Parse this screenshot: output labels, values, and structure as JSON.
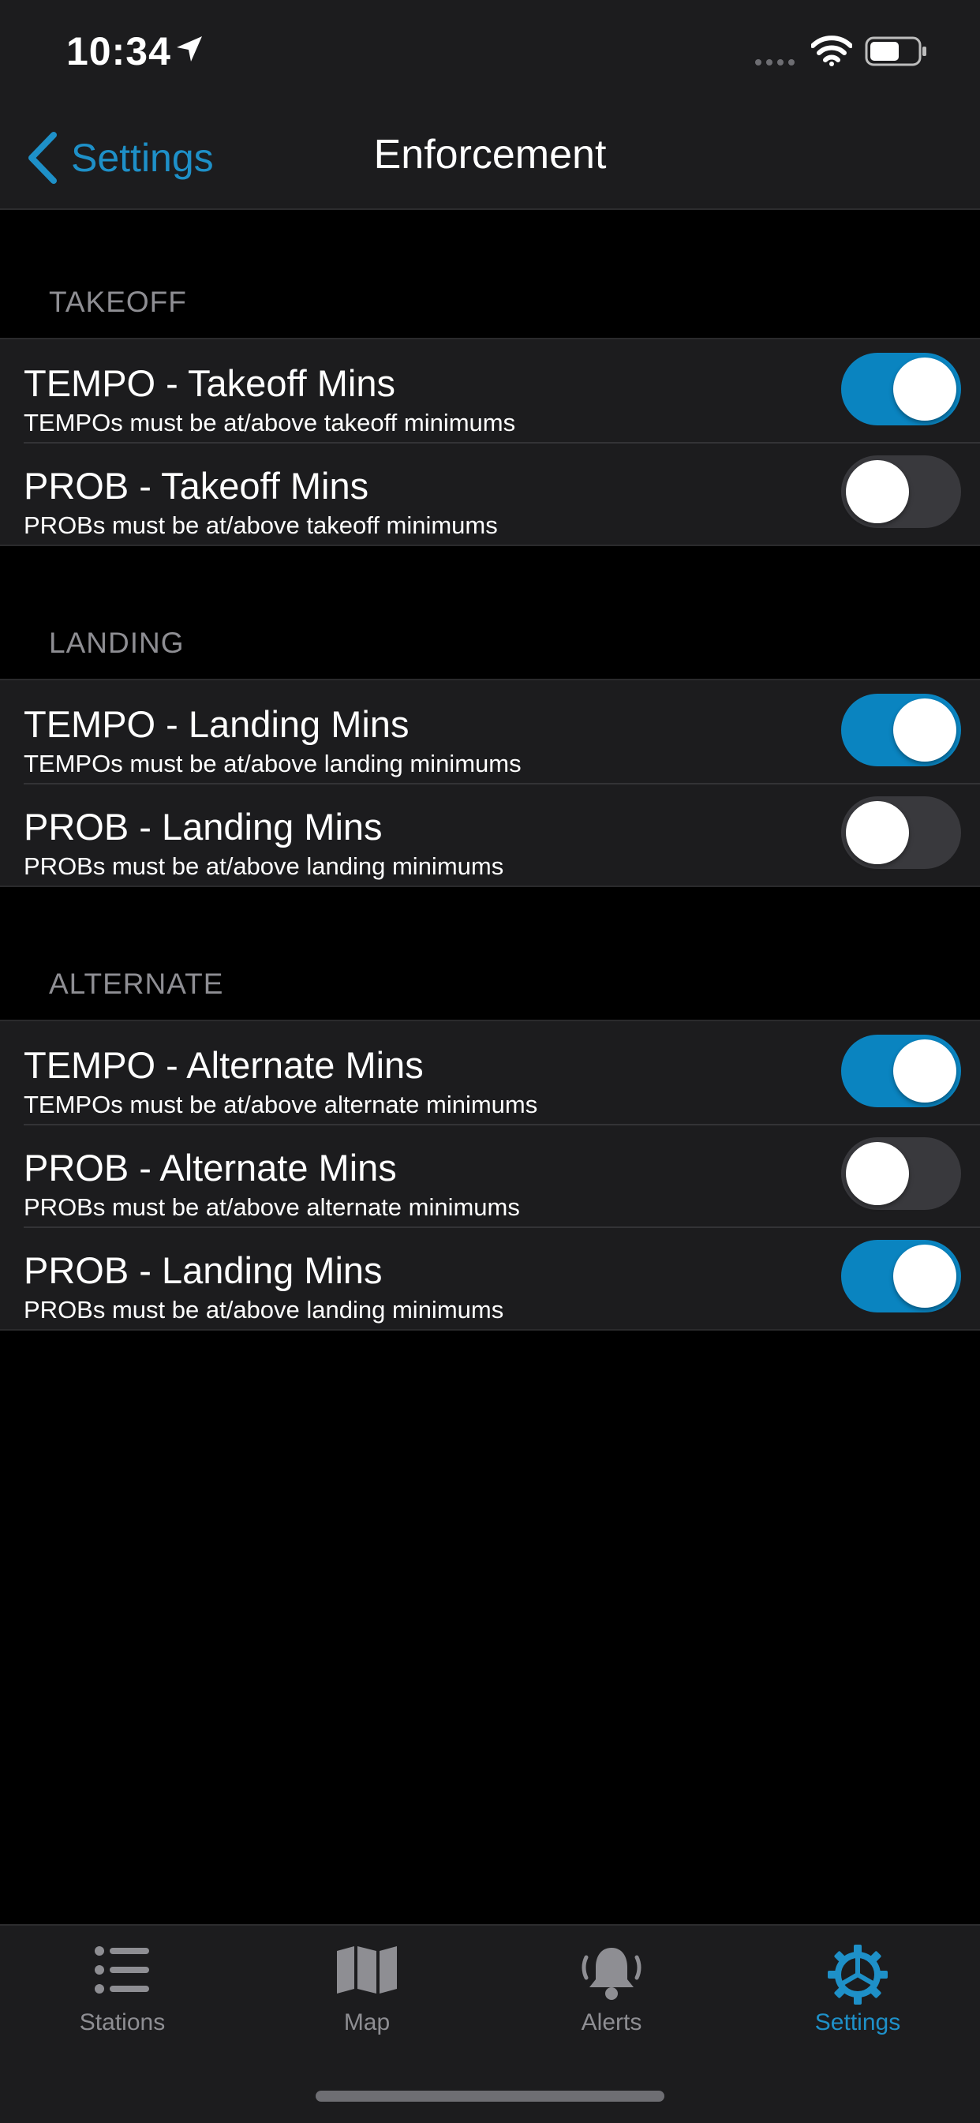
{
  "status_bar": {
    "time": "10:34"
  },
  "nav": {
    "back_label": "Settings",
    "title": "Enforcement"
  },
  "sections": [
    {
      "header": "TAKEOFF",
      "rows": [
        {
          "title": "TEMPO - Takeoff Mins",
          "subtitle": "TEMPOs must be at/above takeoff minimums",
          "on": true
        },
        {
          "title": "PROB - Takeoff Mins",
          "subtitle": "PROBs must be at/above takeoff minimums",
          "on": false
        }
      ]
    },
    {
      "header": "LANDING",
      "rows": [
        {
          "title": "TEMPO - Landing Mins",
          "subtitle": "TEMPOs must be at/above landing minimums",
          "on": true
        },
        {
          "title": "PROB - Landing Mins",
          "subtitle": "PROBs must be at/above landing minimums",
          "on": false
        }
      ]
    },
    {
      "header": "ALTERNATE",
      "rows": [
        {
          "title": "TEMPO - Alternate Mins",
          "subtitle": "TEMPOs must be at/above alternate minimums",
          "on": true
        },
        {
          "title": "PROB - Alternate Mins",
          "subtitle": "PROBs must be at/above alternate minimums",
          "on": false
        },
        {
          "title": "PROB - Landing Mins",
          "subtitle": "PROBs must be at/above landing minimums",
          "on": true
        }
      ]
    }
  ],
  "tabs": [
    {
      "label": "Stations",
      "icon": "list-icon",
      "active": false
    },
    {
      "label": "Map",
      "icon": "map-icon",
      "active": false
    },
    {
      "label": "Alerts",
      "icon": "bell-icon",
      "active": false
    },
    {
      "label": "Settings",
      "icon": "gear-icon",
      "active": true
    }
  ],
  "colors": {
    "accent": "#1e90c8",
    "toggle_on": "#0a84c0",
    "toggle_off": "#39393d",
    "background": "#000000",
    "cell": "#1c1c1e"
  }
}
